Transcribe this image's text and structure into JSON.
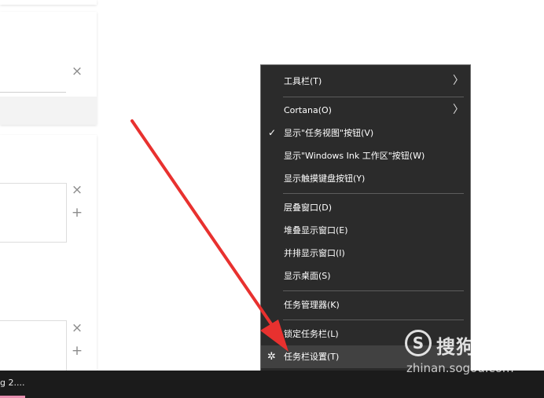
{
  "settings_panel": {
    "close_symbol": "×",
    "add_symbol": "+"
  },
  "context_menu": {
    "items": [
      {
        "label": "工具栏(T)",
        "submenu": true
      },
      {
        "label": "Cortana(O)",
        "submenu": true
      },
      {
        "label": "显示\"任务视图\"按钮(V)",
        "checked": true
      },
      {
        "label": "显示\"Windows Ink 工作区\"按钮(W)"
      },
      {
        "label": "显示触摸键盘按钮(Y)"
      },
      {
        "label": "层叠窗口(D)"
      },
      {
        "label": "堆叠显示窗口(E)"
      },
      {
        "label": "并排显示窗口(I)"
      },
      {
        "label": "显示桌面(S)"
      },
      {
        "label": "任务管理器(K)"
      },
      {
        "label": "锁定任务栏(L)"
      },
      {
        "label": "任务栏设置(T)",
        "icon": "gear-icon",
        "highlighted": true
      }
    ],
    "chevron": "〉",
    "check": "✓",
    "gear": "✲"
  },
  "taskbar": {
    "window_title": "g 2...."
  },
  "watermark": {
    "logo_letter": "S",
    "brand": "搜狗指南",
    "url": "zhinan.sogou.com"
  },
  "colors": {
    "menu_bg": "#2b2b2b",
    "menu_highlight": "#414141",
    "arrow": "#e8312f",
    "taskbar": "#1b1b1b"
  }
}
